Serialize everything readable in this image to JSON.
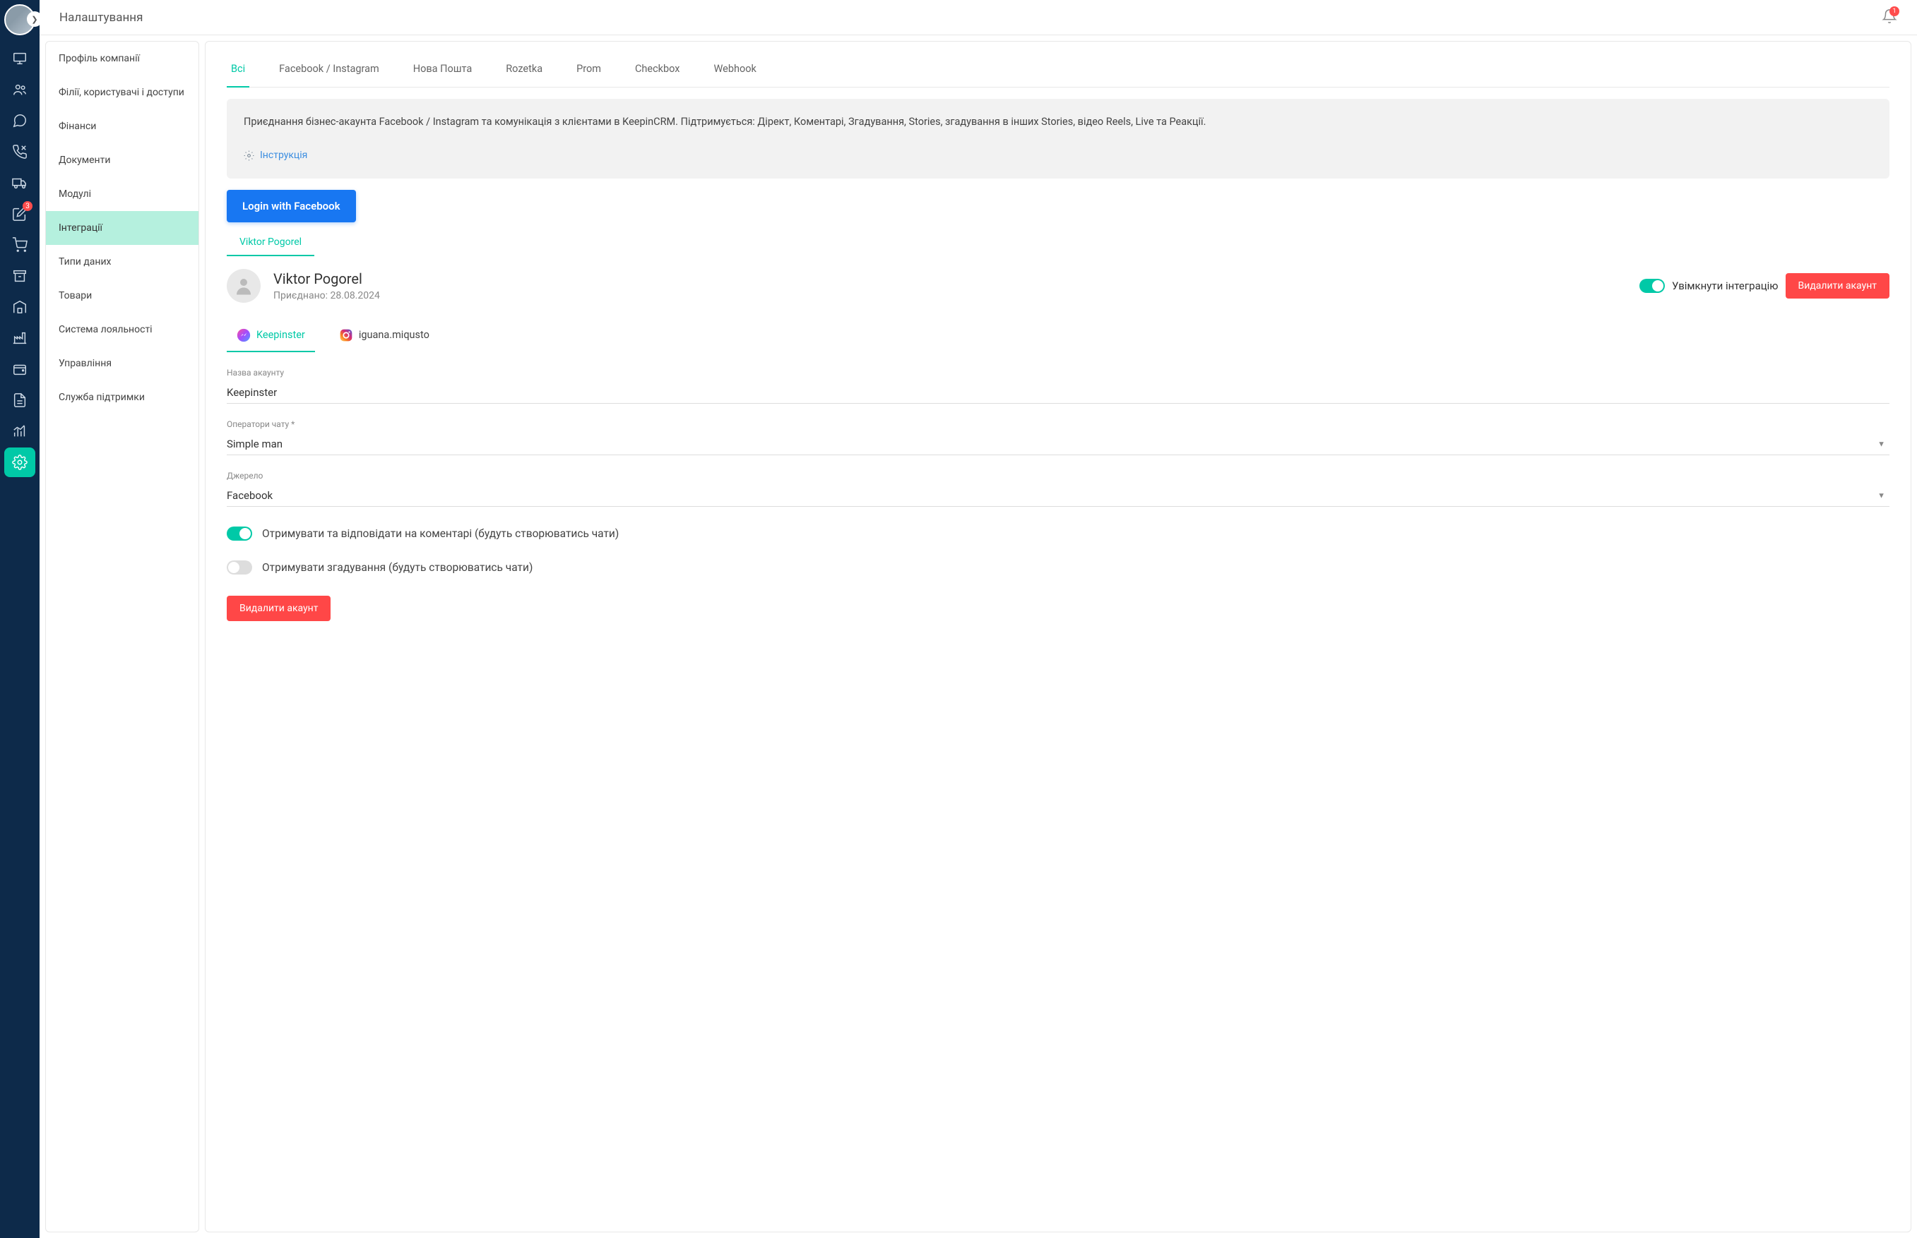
{
  "header": {
    "title": "Налаштування",
    "notifCount": "1"
  },
  "iconBadges": {
    "edit": "3"
  },
  "settingsSidebar": {
    "items": [
      {
        "label": "Профіль компанії",
        "active": false
      },
      {
        "label": "Філії, користувачі і доступи",
        "active": false
      },
      {
        "label": "Фінанси",
        "active": false
      },
      {
        "label": "Документи",
        "active": false
      },
      {
        "label": "Модулі",
        "active": false
      },
      {
        "label": "Інтеграції",
        "active": true
      },
      {
        "label": "Типи даних",
        "active": false
      },
      {
        "label": "Товари",
        "active": false
      },
      {
        "label": "Система лояльності",
        "active": false
      },
      {
        "label": "Управління",
        "active": false
      },
      {
        "label": "Служба підтримки",
        "active": false
      }
    ]
  },
  "tabs": {
    "items": [
      {
        "label": "Всі",
        "active": true
      },
      {
        "label": "Facebook / Instagram",
        "active": false
      },
      {
        "label": "Нова Пошта",
        "active": false
      },
      {
        "label": "Rozetka",
        "active": false
      },
      {
        "label": "Prom",
        "active": false
      },
      {
        "label": "Checkbox",
        "active": false
      },
      {
        "label": "Webhook",
        "active": false
      }
    ]
  },
  "infoBox": {
    "text": "Приєднання бізнес-акаунта Facebook / Instagram та комунікація з клієнтами в KeepinCRM. Підтримується: Дірект, Коментарі, Згадування, Stories, згадування в інших Stories, відео Reels, Live та Реакції.",
    "instructionLabel": "Інструкція"
  },
  "fbButton": {
    "label": "Login with Facebook"
  },
  "subTabs": {
    "items": [
      {
        "label": "Viktor Pogorel",
        "active": true
      }
    ]
  },
  "profile": {
    "name": "Viktor Pogorel",
    "joinedLabel": "Приєднано: 28.08.2024",
    "enableLabel": "Увімкнути інтеграцію",
    "deleteLabel": "Видалити акаунт"
  },
  "channels": {
    "items": [
      {
        "label": "Keepinster",
        "type": "messenger",
        "active": true
      },
      {
        "label": "iguana.miqusto",
        "type": "instagram",
        "active": false
      }
    ]
  },
  "form": {
    "accountNameLabel": "Назва акаунту",
    "accountNameValue": "Keepinster",
    "operatorsLabel": "Оператори чату *",
    "operatorsValue": "Simple man",
    "sourceLabel": "Джерело",
    "sourceValue": "Facebook"
  },
  "toggles": {
    "commentsLabel": "Отримувати та відповідати на коментарі (будуть створюватись чати)",
    "mentionsLabel": "Отримувати згадування (будуть створюватись чати)"
  },
  "deleteBtn": {
    "label": "Видалити акаунт"
  }
}
